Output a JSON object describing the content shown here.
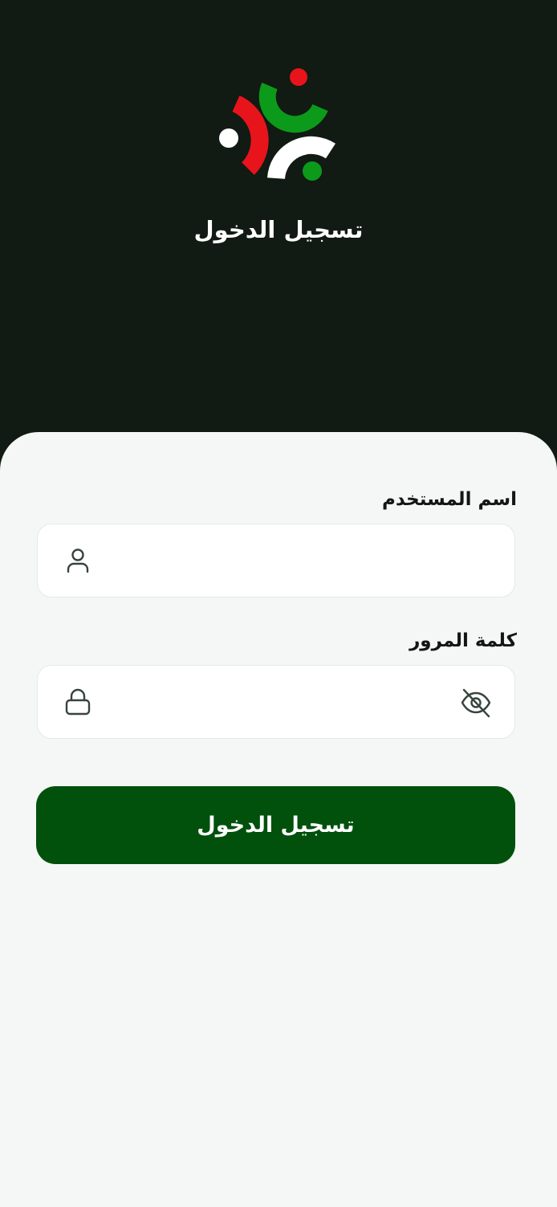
{
  "header": {
    "logo_icon": "brand-logo-icon",
    "title": "تسجيل الدخول"
  },
  "form": {
    "username": {
      "label": "اسم المستخدم",
      "value": "",
      "placeholder": "",
      "icon": "user-icon"
    },
    "password": {
      "label": "كلمة المرور",
      "value": "",
      "placeholder": "",
      "icon": "lock-icon",
      "toggle_icon": "eye-off-icon"
    },
    "submit_label": "تسجيل الدخول"
  },
  "colors": {
    "background_dark": "#111a13",
    "sheet": "#f4f7f6",
    "primary": "#01500c",
    "logo_red": "#e8141b",
    "logo_green": "#0c9a1a",
    "logo_white": "#ffffff"
  }
}
